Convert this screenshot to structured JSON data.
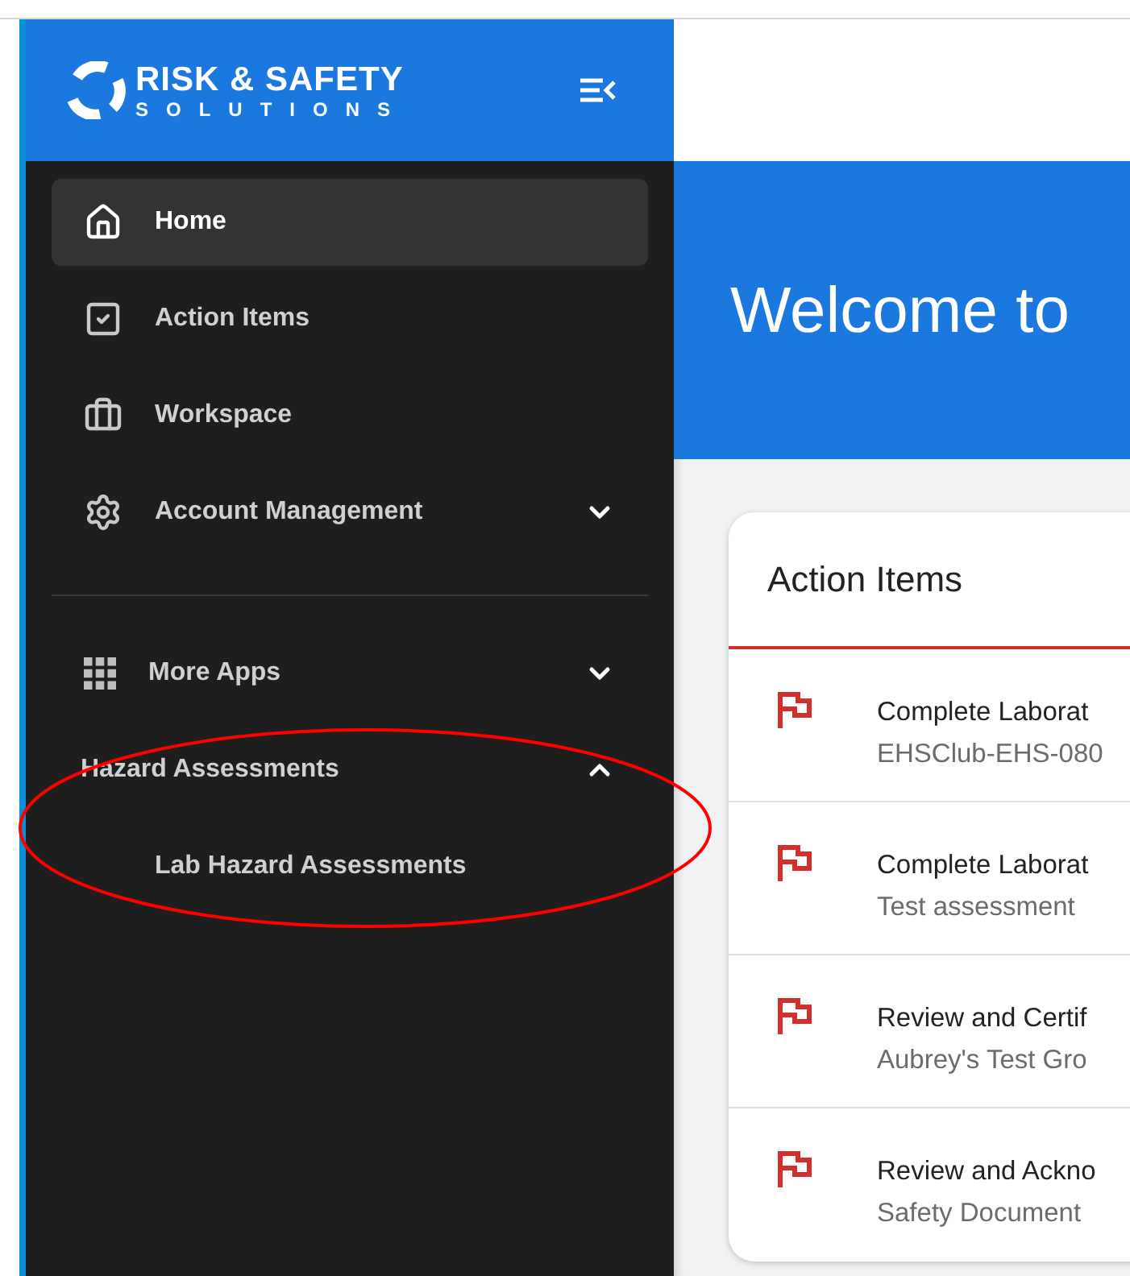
{
  "brand": {
    "name": "RISK & SAFETY",
    "tagline": "SOLUTIONS"
  },
  "sidebar": {
    "items": [
      {
        "kind": "link",
        "label": "Home",
        "selected": true
      },
      {
        "kind": "link",
        "label": "Action Items",
        "selected": false
      },
      {
        "kind": "link",
        "label": "Workspace",
        "selected": false
      },
      {
        "kind": "group",
        "label": "Account Management",
        "selected": false,
        "expanded": false
      }
    ],
    "apps": [
      {
        "kind": "group",
        "label": "More Apps",
        "selected": false,
        "expanded": false
      },
      {
        "kind": "section",
        "label": "Hazard Assessments",
        "selected": false,
        "expanded": true,
        "children": [
          {
            "label": "Lab Hazard Assessments",
            "selected": false
          }
        ]
      }
    ]
  },
  "banner": {
    "title": "Welcome to"
  },
  "action_items": {
    "title": "Action Items",
    "rows": [
      {
        "title": "Complete Laborat",
        "subtitle": "EHSClub-EHS-080"
      },
      {
        "title": "Complete Laborat",
        "subtitle": "Test assessment"
      },
      {
        "title": "Review and Certif",
        "subtitle": "Aubrey's Test Gro"
      },
      {
        "title": "Review and Ackno",
        "subtitle": "Safety Document"
      }
    ]
  }
}
